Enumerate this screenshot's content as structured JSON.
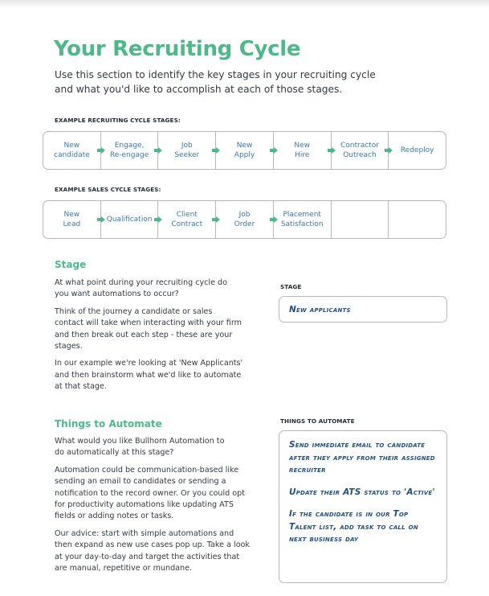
{
  "page": {
    "title": "Your Recruiting Cycle",
    "intro": "Use this section to identify the key stages in your recruiting cycle and what you'd like to accomplish at each of those stages.",
    "accent_color": "#4bb98a",
    "link_text_color": "#3e78a8",
    "handwriting_color": "#1f4e84"
  },
  "recruiting_cycle": {
    "label": "EXAMPLE RECRUITING CYCLE STAGES:",
    "stages": [
      {
        "line1": "New",
        "line2": "candidate"
      },
      {
        "line1": "Engage,",
        "line2": "Re-engage"
      },
      {
        "line1": "Job",
        "line2": "Seeker"
      },
      {
        "line1": "New",
        "line2": "Apply"
      },
      {
        "line1": "New",
        "line2": "Hire"
      },
      {
        "line1": "Contractor",
        "line2": "Outreach"
      },
      {
        "line1": "Redeploy",
        "line2": ""
      }
    ]
  },
  "sales_cycle": {
    "label": "EXAMPLE SALES CYCLE STAGES:",
    "stages": [
      {
        "line1": "New",
        "line2": "Lead"
      },
      {
        "line1": "Qualification",
        "line2": ""
      },
      {
        "line1": "Client",
        "line2": "Contract"
      },
      {
        "line1": "Job",
        "line2": "Order"
      },
      {
        "line1": "Placement",
        "line2": "Satisfaction"
      },
      {
        "line1": "",
        "line2": ""
      },
      {
        "line1": "",
        "line2": ""
      }
    ]
  },
  "stage_section": {
    "heading": "Stage",
    "paragraphs": [
      "At what point during your recruiting cycle do you want automations to occur?",
      "Think of the journey a candidate or sales contact will take when interacting with your firm and then break out each step - these are your stages.",
      "In our example we're looking at 'New Applicants' and then brainstorm what we'd like to automate at that stage."
    ],
    "box_label": "STAGE",
    "box_value": "New applicants"
  },
  "automate_section": {
    "heading": "Things to Automate",
    "paragraphs": [
      "What would you like Bullhorn Automation to do automatically at this stage?",
      "Automation could be communication-based like sending an email to candidates or sending a notification to the record owner. Or you could opt for productivity automations like updating ATS fields or adding notes or tasks.",
      "Our advice: start with simple automations and then expand as new use cases pop up. Take a look at your day-to-day and target the activities that are manual, repetitive or mundane."
    ],
    "box_label": "THINGS TO AUTOMATE",
    "box_items": [
      "Send immediate email to candidate after they apply from their assigned recruiter",
      "Update their ATS status to 'Active'",
      "If the candidate is in our Top Talent list, add task to call on next business day"
    ]
  }
}
